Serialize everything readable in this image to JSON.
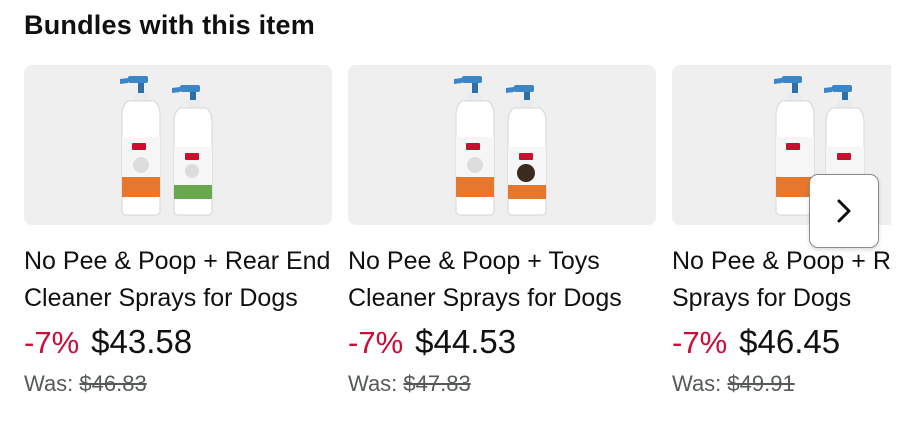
{
  "section": {
    "title": "Bundles with this item"
  },
  "cards": [
    {
      "title": "No Pee & Poop + Rear End Cleaner Sprays for Dogs",
      "discount": "-7%",
      "price": "$43.58",
      "was_label": "Was:",
      "was_price": "$46.83",
      "image_icon": "spray-bottles-image",
      "second_label_color": "#6aa84f"
    },
    {
      "title": "No Pee & Poop + Toys Cleaner Sprays for Dogs",
      "discount": "-7%",
      "price": "$44.53",
      "was_label": "Was:",
      "was_price": "$47.83",
      "image_icon": "spray-bottles-image",
      "second_label_color": "#e8772e"
    },
    {
      "title": "No Pee & Poop + Remover Sprays for Dogs",
      "discount": "-7%",
      "price": "$46.45",
      "was_label": "Was:",
      "was_price": "$49.91",
      "image_icon": "spray-bottles-image",
      "second_label_color": "#e8772e"
    }
  ],
  "carousel": {
    "next_icon": "chevron-right-icon"
  },
  "colors": {
    "discount": "#cc0c39",
    "image_background": "#efefef",
    "muted_text": "#565959"
  }
}
